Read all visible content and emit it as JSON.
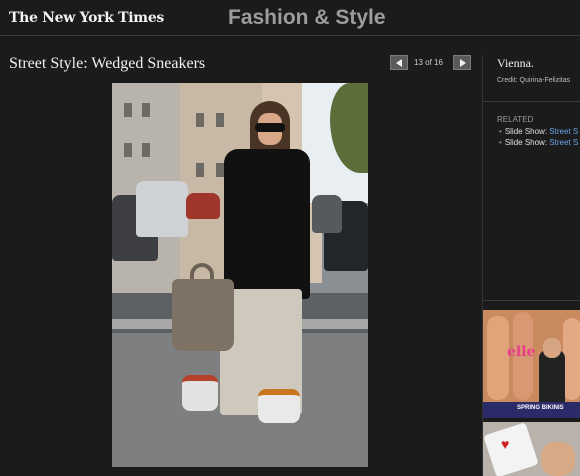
{
  "header": {
    "logo_text": "The New York Times",
    "section_title": "Fashion & Style"
  },
  "slideshow": {
    "title": "Street Style: Wedged Sneakers",
    "counter": "13 of 16",
    "prev_icon": "arrow-left-icon",
    "next_icon": "arrow-right-icon"
  },
  "caption": {
    "text": "Vienna.",
    "credit": "Credit: Quirina-Felizitas"
  },
  "related": {
    "title": "RELATED",
    "items": [
      {
        "prefix": "Slide Show:",
        "link": "Street S"
      },
      {
        "prefix": "Slide Show:",
        "link": "Street S"
      }
    ]
  },
  "ads": {
    "thumb1_magazine": "elle",
    "thumb1_caption": "SPRING BIKINIS"
  },
  "colors": {
    "background": "#1b1b1b",
    "link": "#6aa6e8",
    "section_title": "#9c9c9c"
  }
}
